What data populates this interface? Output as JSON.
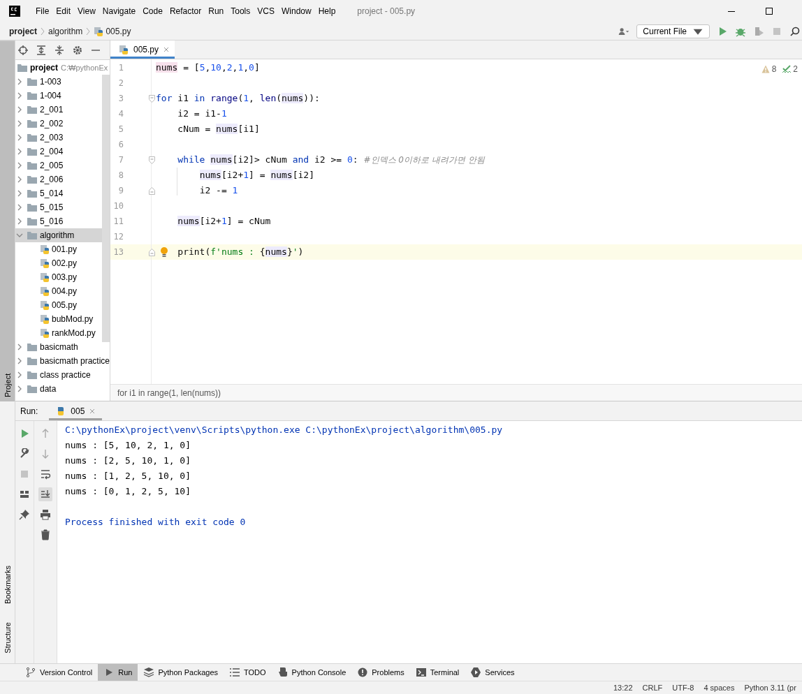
{
  "menu_bar": {
    "items": [
      "File",
      "Edit",
      "View",
      "Navigate",
      "Code",
      "Refactor",
      "Run",
      "Tools",
      "VCS",
      "Window",
      "Help"
    ],
    "title": "project - 005.py"
  },
  "nav_bar": {
    "breadcrumbs": [
      "project",
      "algorithm",
      "005.py"
    ],
    "run_config": "Current File"
  },
  "left_strip": {
    "top_tabs": [
      {
        "label": "Project",
        "selected": true
      }
    ],
    "bottom_tabs": [
      {
        "label": "Bookmarks",
        "selected": false
      },
      {
        "label": "Structure",
        "selected": false
      }
    ]
  },
  "project_panel": {
    "tree": [
      {
        "label": "project",
        "path": "C:₩pythonEx",
        "kind": "folder",
        "selected": false,
        "children": [
          {
            "label": "1-003",
            "kind": "folder",
            "expanded": false,
            "selected": false
          },
          {
            "label": "1-004",
            "kind": "folder",
            "expanded": false,
            "selected": false
          },
          {
            "label": "2_001",
            "kind": "folder",
            "expanded": false,
            "selected": false
          },
          {
            "label": "2_002",
            "kind": "folder",
            "expanded": false,
            "selected": false
          },
          {
            "label": "2_003",
            "kind": "folder",
            "expanded": false,
            "selected": false
          },
          {
            "label": "2_004",
            "kind": "folder",
            "expanded": false,
            "selected": false
          },
          {
            "label": "2_005",
            "kind": "folder",
            "expanded": false,
            "selected": false
          },
          {
            "label": "2_006",
            "kind": "folder",
            "expanded": false,
            "selected": false
          },
          {
            "label": "5_014",
            "kind": "folder",
            "expanded": false,
            "selected": false
          },
          {
            "label": "5_015",
            "kind": "folder",
            "expanded": false,
            "selected": false
          },
          {
            "label": "5_016",
            "kind": "folder",
            "expanded": false,
            "selected": false
          },
          {
            "label": "algorithm",
            "kind": "folder",
            "expanded": true,
            "selected": true,
            "children": [
              {
                "label": "001.py",
                "kind": "python",
                "selected": false
              },
              {
                "label": "002.py",
                "kind": "python",
                "selected": false
              },
              {
                "label": "003.py",
                "kind": "python",
                "selected": false
              },
              {
                "label": "004.py",
                "kind": "python",
                "selected": false
              },
              {
                "label": "005.py",
                "kind": "python",
                "selected": false
              },
              {
                "label": "bubMod.py",
                "kind": "python",
                "selected": false
              },
              {
                "label": "rankMod.py",
                "kind": "python",
                "selected": false
              }
            ]
          },
          {
            "label": "basicmath",
            "kind": "folder",
            "expanded": false,
            "selected": false
          },
          {
            "label": "basicmath practice",
            "kind": "folder",
            "expanded": false,
            "selected": false
          },
          {
            "label": "class practice",
            "kind": "folder",
            "expanded": false,
            "selected": false
          },
          {
            "label": "data",
            "kind": "folder",
            "expanded": false,
            "selected": false
          }
        ]
      }
    ]
  },
  "editor": {
    "tabs": [
      {
        "label": "005.py",
        "selected": true
      }
    ],
    "inspections": {
      "warnings": "8",
      "typos": "2"
    },
    "lines": [
      {
        "number": "1",
        "tokens": [
          {
            "kind": "decl",
            "text": "nums"
          },
          {
            "kind": "plain",
            "text": " = ["
          },
          {
            "kind": "num",
            "text": "5"
          },
          {
            "kind": "plain",
            "text": ","
          },
          {
            "kind": "num",
            "text": "10"
          },
          {
            "kind": "plain",
            "text": ","
          },
          {
            "kind": "num",
            "text": "2"
          },
          {
            "kind": "plain",
            "text": ","
          },
          {
            "kind": "num",
            "text": "1"
          },
          {
            "kind": "plain",
            "text": ","
          },
          {
            "kind": "num",
            "text": "0"
          },
          {
            "kind": "plain",
            "text": "]"
          }
        ]
      },
      {
        "number": "2"
      },
      {
        "number": "3",
        "fold_start": true,
        "tokens": [
          {
            "kind": "kw",
            "text": "for"
          },
          {
            "kind": "plain",
            "text": " i1 "
          },
          {
            "kind": "kw",
            "text": "in"
          },
          {
            "kind": "builtin",
            "text": " range"
          },
          {
            "kind": "plain",
            "text": "("
          },
          {
            "kind": "num",
            "text": "1"
          },
          {
            "kind": "plain",
            "text": ", "
          },
          {
            "kind": "builtin",
            "text": "len"
          },
          {
            "kind": "plain",
            "text": "("
          },
          {
            "kind": "usage",
            "text": "nums"
          },
          {
            "kind": "plain",
            "text": ")):"
          }
        ]
      },
      {
        "number": "4",
        "tokens": [
          {
            "kind": "plain",
            "text": "    i2 = i1-"
          },
          {
            "kind": "num",
            "text": "1"
          }
        ]
      },
      {
        "number": "5",
        "tokens": [
          {
            "kind": "plain",
            "text": "    cNum = "
          },
          {
            "kind": "usage",
            "text": "nums"
          },
          {
            "kind": "plain",
            "text": "[i1]"
          }
        ]
      },
      {
        "number": "6"
      },
      {
        "number": "7",
        "fold_start": true,
        "tokens": [
          {
            "kind": "kw",
            "text": "    while "
          },
          {
            "kind": "usage",
            "text": "nums"
          },
          {
            "kind": "plain",
            "text": "[i2]> cNum "
          },
          {
            "kind": "kw",
            "text": "and"
          },
          {
            "kind": "plain",
            "text": " i2 >= "
          },
          {
            "kind": "num",
            "text": "0"
          },
          {
            "kind": "plain",
            "text": ": "
          },
          {
            "kind": "comment",
            "text": "#인덱스 0이하로 내려가면 안됨"
          }
        ]
      },
      {
        "number": "8",
        "tokens": [
          {
            "kind": "usage",
            "text": "        nums"
          },
          {
            "kind": "plain",
            "text": "[i2+"
          },
          {
            "kind": "num",
            "text": "1"
          },
          {
            "kind": "plain",
            "text": "] = "
          },
          {
            "kind": "usage",
            "text": "nums"
          },
          {
            "kind": "plain",
            "text": "[i2]"
          }
        ]
      },
      {
        "number": "9",
        "fold_end": true,
        "tokens": [
          {
            "kind": "plain",
            "text": "        i2 -= "
          },
          {
            "kind": "num",
            "text": "1"
          }
        ]
      },
      {
        "number": "10"
      },
      {
        "number": "11",
        "tokens": [
          {
            "kind": "usage",
            "text": "    nums"
          },
          {
            "kind": "plain",
            "text": "[i2+"
          },
          {
            "kind": "num",
            "text": "1"
          },
          {
            "kind": "plain",
            "text": "] = cNum"
          }
        ]
      },
      {
        "number": "12"
      },
      {
        "number": "13",
        "fold_end": true,
        "current": true,
        "bulb": true,
        "tokens": [
          {
            "kind": "plain",
            "text": "    print("
          },
          {
            "kind": "string",
            "text": "f'nums : "
          },
          {
            "kind": "plain",
            "text": "{"
          },
          {
            "kind": "usage",
            "text": "nums"
          },
          {
            "kind": "plain",
            "text": "}"
          },
          {
            "kind": "string",
            "text": "'"
          },
          {
            "kind": "plain",
            "text": ")"
          }
        ]
      }
    ],
    "breadcrumb": "for i1 in range(1, len(nums))"
  },
  "run_panel": {
    "label": "Run:",
    "tabs": [
      {
        "label": "005",
        "selected": true
      }
    ],
    "console": [
      {
        "kind": "command",
        "text": "C:\\pythonEx\\project\\venv\\Scripts\\python.exe C:\\pythonEx\\project\\algorithm\\005.py"
      },
      {
        "kind": "output",
        "text": "nums : [5, 10, 2, 1, 0]"
      },
      {
        "kind": "output",
        "text": "nums : [2, 5, 10, 1, 0]"
      },
      {
        "kind": "output",
        "text": "nums : [1, 2, 5, 10, 0]"
      },
      {
        "kind": "output",
        "text": "nums : [0, 1, 2, 5, 10]"
      },
      {
        "kind": "exit",
        "text": "Process finished with exit code 0"
      }
    ]
  },
  "tool_windows": [
    {
      "label": "Version Control",
      "selected": false
    },
    {
      "label": "Run",
      "selected": true
    },
    {
      "label": "Python Packages",
      "selected": false
    },
    {
      "label": "TODO",
      "selected": false
    },
    {
      "label": "Python Console",
      "selected": false
    },
    {
      "label": "Problems",
      "selected": false
    },
    {
      "label": "Terminal",
      "selected": false
    },
    {
      "label": "Services",
      "selected": false
    }
  ],
  "status_bar": [
    "13:22",
    "CRLF",
    "UTF-8",
    "4 spaces",
    "Python 3.11 (pr"
  ]
}
